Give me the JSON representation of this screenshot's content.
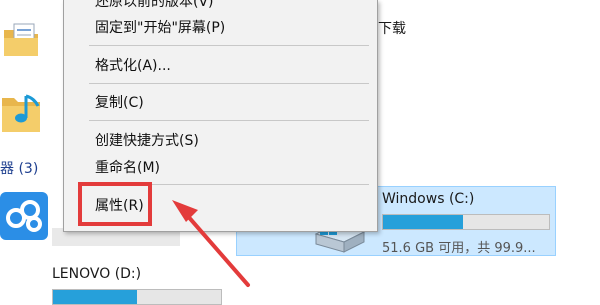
{
  "context_menu": {
    "items": [
      {
        "label": "还原以前的版本(V)"
      },
      {
        "label": "固定到\"开始\"屏幕(P)"
      },
      {
        "label": "格式化(A)..."
      },
      {
        "label": "复制(C)"
      },
      {
        "label": "创建快捷方式(S)"
      },
      {
        "label": "重命名(M)"
      },
      {
        "label": "属性(R)"
      }
    ]
  },
  "explorer": {
    "downloads_label": "下载",
    "group_header": "器 (3)",
    "drive_c": {
      "name": "Windows (C:)",
      "space": "51.6 GB 可用，共 99.9...",
      "used_fraction": 0.48
    },
    "drive_d": {
      "name": "LENOVO (D:)",
      "used_fraction": 0.5
    }
  },
  "colors": {
    "highlight": "#e33b3b",
    "selection": "#cce8ff",
    "bar_fill": "#26a0da"
  }
}
